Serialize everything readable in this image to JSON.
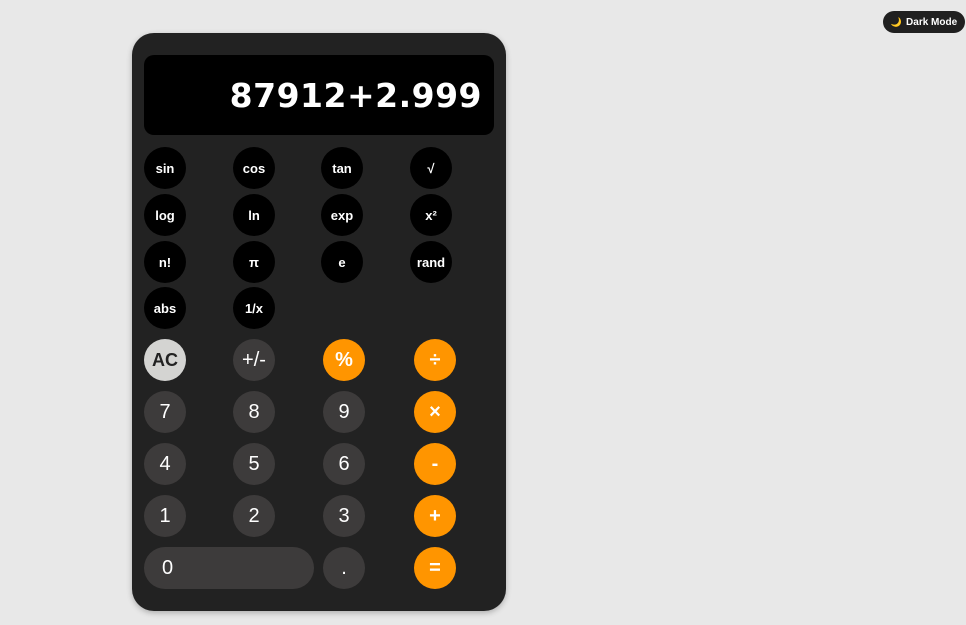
{
  "header": {
    "dark_mode_label": "Dark Mode",
    "dark_mode_icon": "moon-icon"
  },
  "display": {
    "value": "87912+2.999"
  },
  "scientific": {
    "row1": [
      "sin",
      "cos",
      "tan",
      "√"
    ],
    "row2": [
      "log",
      "ln",
      "exp",
      "x²"
    ],
    "row3": [
      "n!",
      "π",
      "e",
      "rand"
    ],
    "row4": [
      "abs",
      "1/x"
    ]
  },
  "keypad": {
    "row1": [
      "AC",
      "+/-",
      "%",
      "÷"
    ],
    "row2": [
      "7",
      "8",
      "9",
      "×"
    ],
    "row3": [
      "4",
      "5",
      "6",
      "-"
    ],
    "row4": [
      "1",
      "2",
      "3",
      "+"
    ],
    "row5": [
      "0",
      ".",
      "="
    ]
  },
  "colors": {
    "operator": "#ff9500",
    "number": "#3d3b3b",
    "clear": "#d4d4d2",
    "body": "#222222",
    "display": "#000000",
    "background": "#e8e8e8"
  }
}
